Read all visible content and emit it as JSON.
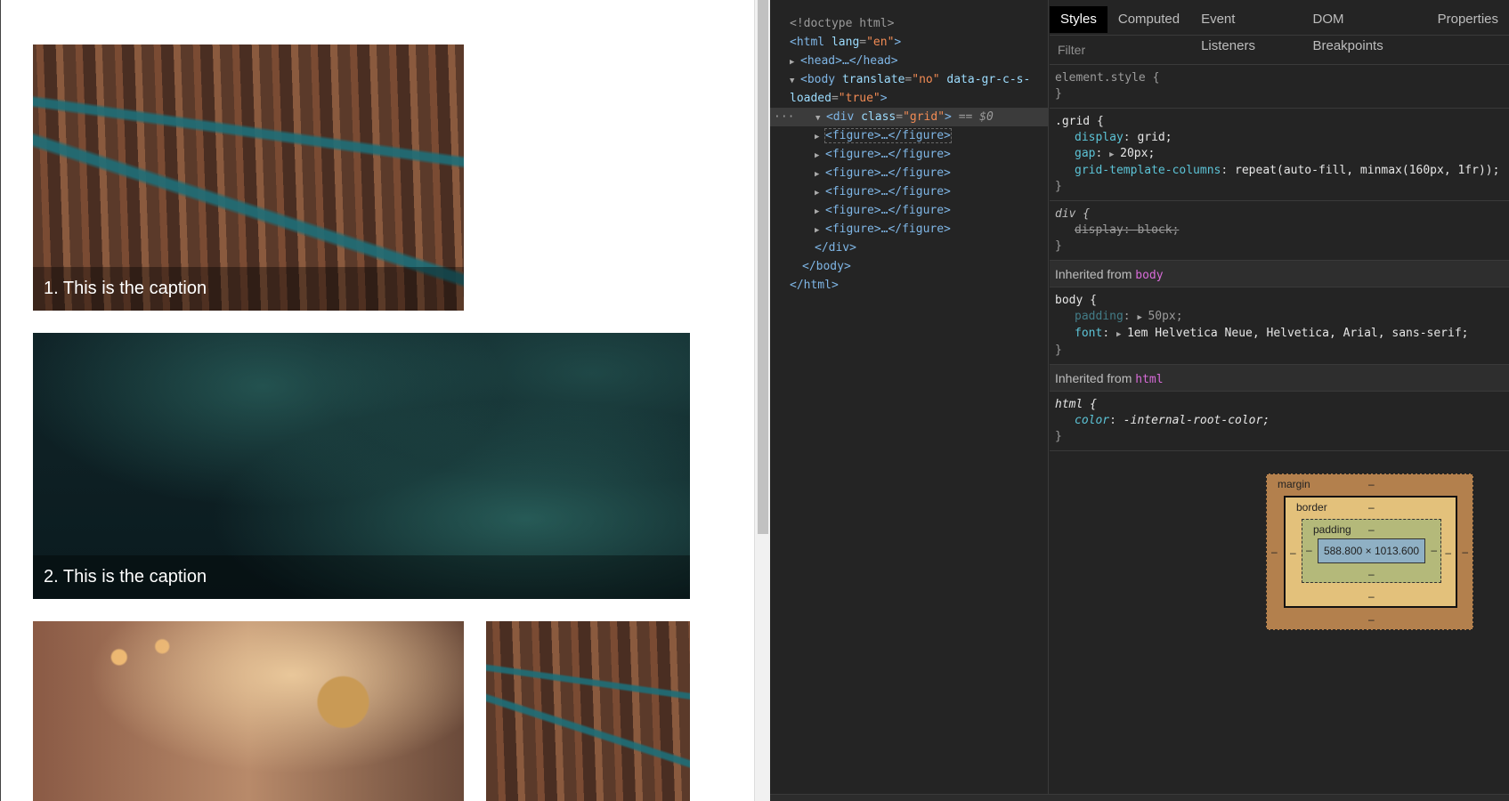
{
  "viewport": {
    "figures": [
      {
        "caption": "1. This is the caption",
        "image": "christmas-lights-on-tree-bark"
      },
      {
        "caption": "2. This is the caption",
        "image": "pine-branches"
      },
      {
        "caption": "",
        "image": "ornament-on-tree"
      },
      {
        "caption": "",
        "image": "christmas-lights-on-tree-bark"
      }
    ]
  },
  "devtools": {
    "dom": {
      "doctype": "<!doctype html>",
      "html_open_tag": "html",
      "html_lang_attr": "lang",
      "html_lang_val": "\"en\"",
      "head": "<head>…</head>",
      "body_tag": "body",
      "body_attr1": "translate",
      "body_val1": "\"no\"",
      "body_attr2": "data-gr-c-s-",
      "body_attr2b": "loaded",
      "body_val2": "\"true\"",
      "div_tag": "div",
      "div_attr": "class",
      "div_val": "\"grid\"",
      "selected_marker": "== $0",
      "ellipsis": "···",
      "figures": [
        "<figure>…</figure>",
        "<figure>…</figure>",
        "<figure>…</figure>",
        "<figure>…</figure>",
        "<figure>…</figure>",
        "<figure>…</figure>"
      ],
      "div_close": "</div>",
      "body_close": "</body>",
      "html_close": "</html>"
    },
    "tabs": [
      "Styles",
      "Computed",
      "Event Listeners",
      "DOM Breakpoints",
      "Properties"
    ],
    "active_tab": "Styles",
    "filter_placeholder": "Filter",
    "rules": {
      "element_style": "element.style {",
      "close": "}",
      "grid_selector": ".grid {",
      "grid_props": [
        {
          "name": "display",
          "value": "grid;"
        },
        {
          "name": "gap",
          "value": "20px;"
        },
        {
          "name": "grid-template-columns",
          "value": "repeat(auto-fill, minmax(160px, 1fr));"
        }
      ],
      "div_selector": "div {",
      "div_prop_name": "display",
      "div_prop_value": "block;",
      "inherited_body_label": "Inherited from",
      "inherited_body_ref": "body",
      "body_selector": "body {",
      "body_props": [
        {
          "name": "padding",
          "value": "50px;"
        },
        {
          "name": "font",
          "value": "1em Helvetica Neue, Helvetica, Arial, sans-serif;"
        }
      ],
      "inherited_html_label": "Inherited from",
      "inherited_html_ref": "html",
      "html_selector": "html {",
      "html_prop_name": "color",
      "html_prop_value": "-internal-root-color;"
    },
    "box_model": {
      "margin_label": "margin",
      "border_label": "border",
      "padding_label": "padding",
      "content_size": "588.800 × 1013.600",
      "dash": "–"
    }
  }
}
